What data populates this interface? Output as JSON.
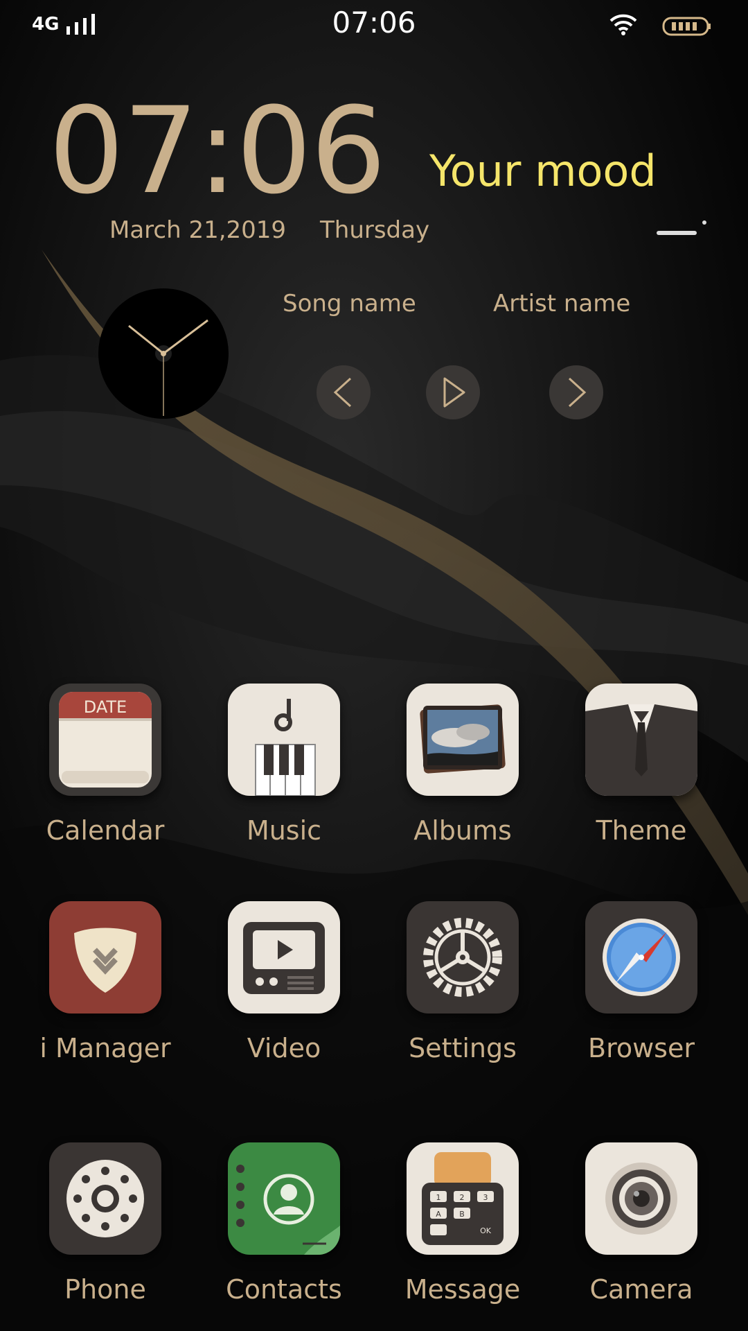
{
  "status_bar": {
    "network": "4G",
    "time": "07:06"
  },
  "clock_widget": {
    "time": "07:06",
    "date": "March 21,2019",
    "day": "Thursday",
    "mood": "Your mood"
  },
  "music_widget": {
    "song": "Song name",
    "artist": "Artist name",
    "icons": [
      "prev-icon",
      "play-icon",
      "next-icon"
    ]
  },
  "apps": [
    {
      "label": "Calendar",
      "icon_text": "DATE"
    },
    {
      "label": "Music"
    },
    {
      "label": "Albums"
    },
    {
      "label": "Theme"
    },
    {
      "label": "i Manager"
    },
    {
      "label": "Video"
    },
    {
      "label": "Settings"
    },
    {
      "label": "Browser"
    },
    {
      "label": "Phone"
    },
    {
      "label": "Contacts"
    },
    {
      "label": "Message",
      "icon_keys": [
        "1",
        "2",
        "3",
        "A",
        "B",
        "OK"
      ]
    },
    {
      "label": "Camera"
    }
  ],
  "colors": {
    "accent_text": "#c9b08c",
    "mood_text": "#f5e56a"
  }
}
